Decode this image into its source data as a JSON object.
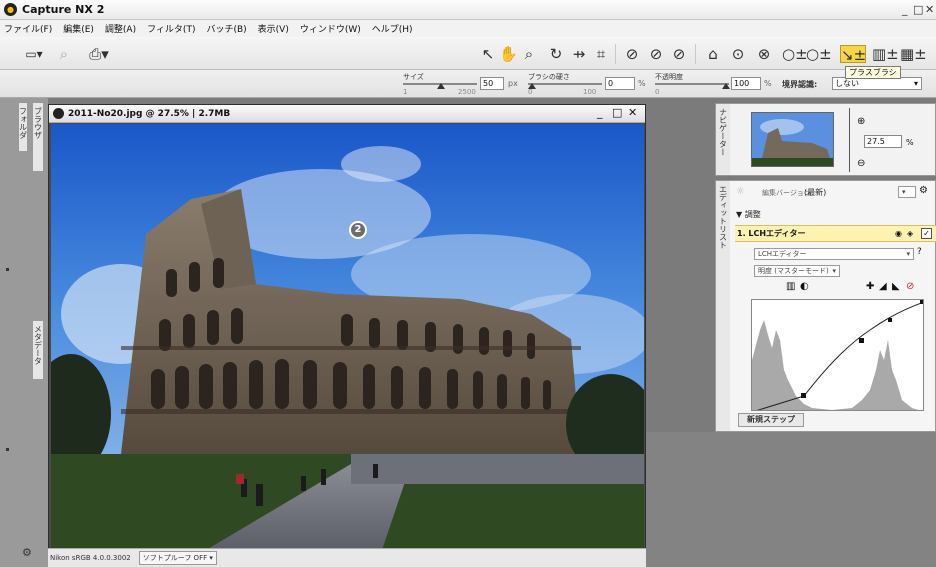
{
  "app": {
    "title": "Capture NX 2"
  },
  "window_controls": [
    "_",
    "□",
    "✕"
  ],
  "menu": [
    "ファイル(F)",
    "編集(E)",
    "調整(A)",
    "フィルタ(T)",
    "バッチ(B)",
    "表示(V)",
    "ウィンドウ(W)",
    "ヘルプ(H)"
  ],
  "toolbar": {
    "tooltip": "プラスブラシ"
  },
  "options_bar": {
    "size_label": "サイズ",
    "size_value": "50",
    "size_unit": "px",
    "size_min": "1",
    "size_max": "2500",
    "hardness_label": "ブラシの硬さ",
    "hardness_value": "0",
    "hardness_unit": "%",
    "hardness_min": "0",
    "hardness_max": "100",
    "opacity_label": "不透明度",
    "opacity_value": "100",
    "opacity_unit": "%",
    "opacity_min": "0",
    "edge_label": "境界認識:",
    "edge_value": "しない"
  },
  "left_dock": {
    "tab_browser": "ブラウザ",
    "tab_folder": "フォルダ",
    "tab_metadata": "メタデータ"
  },
  "image_window": {
    "title": "2011-No20.jpg @ 27.5% | 2.7MB",
    "badge": "2",
    "status_profile": "Nikon sRGB 4.0.0.3002",
    "softproof": "ソフトプルーフ OFF"
  },
  "navigator": {
    "tab_label": "ナビゲーター",
    "zoom_value": "27.5",
    "zoom_unit": "%"
  },
  "edit_list": {
    "tab_label": "エディットリスト",
    "version_label": "編集バージョン",
    "version_value": "(最新)",
    "group_label": "調整",
    "step_label": "1. LCHエディター",
    "editor_select": "LCHエディター",
    "channel_select": "明度 (マスターモード)",
    "new_step": "新規ステップ"
  },
  "colors": {
    "accent": "#fff1b0",
    "panel_bg": "#f5f5f5",
    "workspace_bg": "#7b7b7b",
    "step_delete": "#d0262a"
  }
}
